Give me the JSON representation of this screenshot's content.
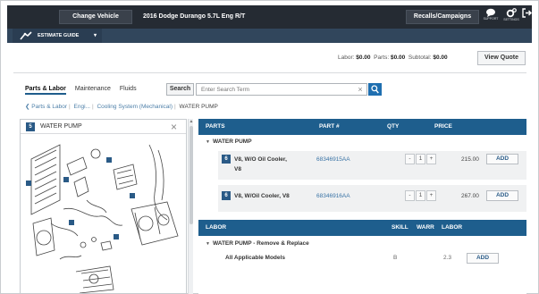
{
  "header": {
    "change_vehicle": "Change Vehicle",
    "vehicle": "2016 Dodge Durango 5.7L Eng R/T",
    "recalls": "Recalls/Campaigns",
    "icons": [
      {
        "name": "chat-icon",
        "label": "SUPPORT"
      },
      {
        "name": "gear-icon",
        "label": "SETTINGS"
      },
      {
        "name": "logout-icon",
        "label": "LOGOUT"
      }
    ]
  },
  "nav": {
    "estimate_guide": "ESTIMATE GUIDE",
    "caret": "▾"
  },
  "totals": {
    "labor_label": "Labor:",
    "labor": "$0.00",
    "parts_label": "Parts:",
    "parts": "$0.00",
    "subtotal_label": "Subtotal:",
    "subtotal": "$0.00",
    "view_quote": "View Quote"
  },
  "tabs": [
    "Parts & Labor",
    "Maintenance",
    "Fluids"
  ],
  "search": {
    "label": "Search",
    "placeholder": "Enter Search Term",
    "clear": "×"
  },
  "breadcrumb": {
    "back": "❮",
    "items": [
      "Parts & Labor",
      "Engi...",
      "Cooling System (Mechanical)"
    ],
    "current": "WATER PUMP"
  },
  "diagram_panel": {
    "badge": "5",
    "title": "WATER PUMP",
    "close": "×"
  },
  "parts_table": {
    "headers": {
      "parts": "PARTS",
      "part_no": "PART #",
      "qty": "QTY",
      "price": "PRICE"
    },
    "group": "WATER PUMP",
    "rows": [
      {
        "badge": "6",
        "desc_line1": "V8, W/O Oil Cooler,",
        "desc_line2": "V8",
        "part_no": "68346915AA",
        "qty": "1",
        "price": "215.00",
        "add": "ADD"
      },
      {
        "badge": "6",
        "desc_line1": "V8, W/Oil Cooler, V8",
        "desc_line2": "",
        "part_no": "68346916AA",
        "qty": "1",
        "price": "267.00",
        "add": "ADD"
      }
    ],
    "minus": "-",
    "plus": "+"
  },
  "labor_table": {
    "headers": {
      "labor": "LABOR",
      "skill": "SKILL",
      "warr": "WARR",
      "labor_col": "LABOR"
    },
    "group": "WATER PUMP - Remove & Replace",
    "rows": [
      {
        "desc": "All Applicable Models",
        "skill": "B",
        "warr": "",
        "hours": "2.3",
        "add": "ADD"
      }
    ]
  },
  "colors": {
    "topbar": "#252b33",
    "navbar": "#31465c",
    "table_header": "#1e5e8d",
    "link": "#3b74a6"
  }
}
